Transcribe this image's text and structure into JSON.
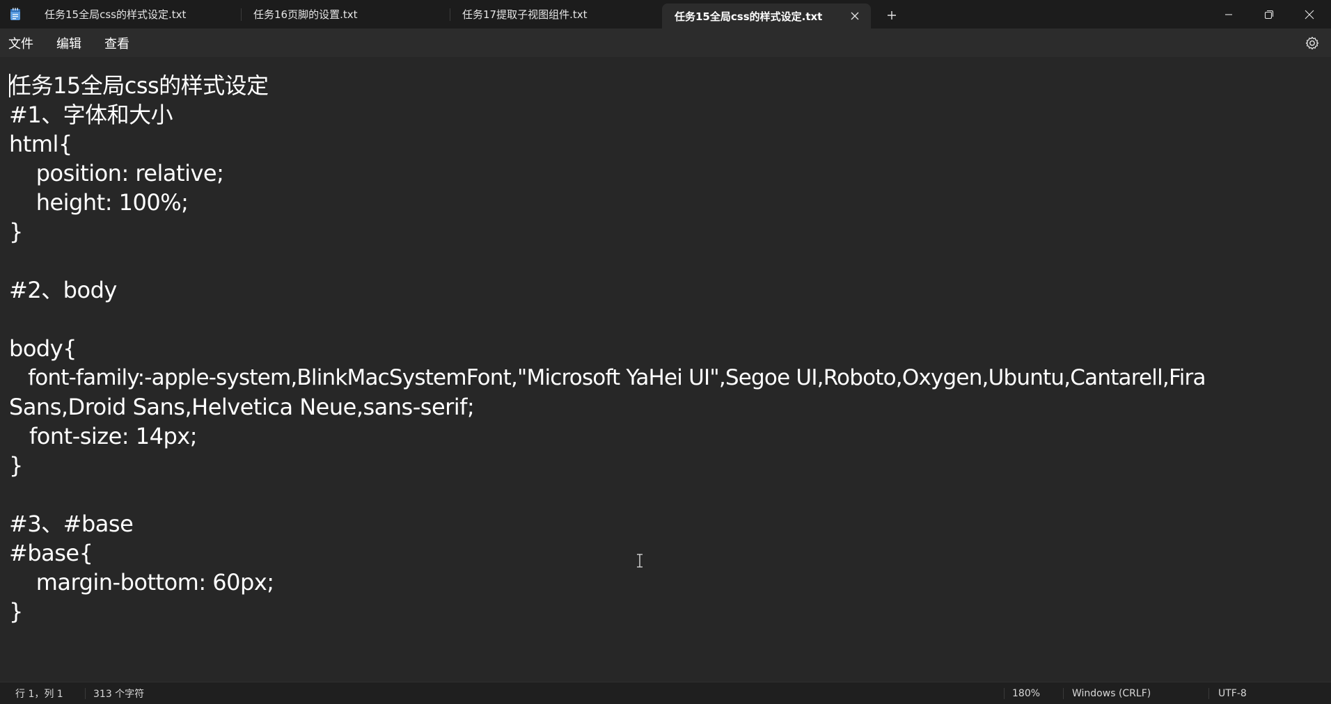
{
  "tabs": [
    {
      "label": "任务15全局css的样式设定.txt",
      "active": false
    },
    {
      "label": "任务16页脚的设置.txt",
      "active": false
    },
    {
      "label": "任务17提取子视图组件.txt",
      "active": false
    },
    {
      "label": "任务15全局css的样式设定.txt",
      "active": true
    }
  ],
  "menu": {
    "file": "文件",
    "edit": "编辑",
    "view": "查看"
  },
  "icons": {
    "app": "notepad-icon",
    "close_tab": "close-icon",
    "new_tab": "plus-icon",
    "minimize": "minimize-icon",
    "restore": "restore-icon",
    "close_window": "close-window-icon",
    "settings": "gear-icon",
    "cursor": "text-cursor-icon"
  },
  "document": {
    "lines": [
      "任务15全局css的样式设定",
      "#1、字体和大小",
      "html{",
      "    position: relative;",
      "    height: 100%;",
      "}",
      "",
      "#2、body",
      "",
      "body{",
      "   font-family:-apple-system,BlinkMacSystemFont,\"Microsoft YaHei UI\",Segoe UI,Roboto,Oxygen,Ubuntu,Cantarell,Fira",
      "Sans,Droid Sans,Helvetica Neue,sans-serif;",
      "   font-size: 14px;",
      "}",
      "",
      "#3、#base",
      "#base{",
      "    margin-bottom: 60px;",
      "}"
    ]
  },
  "status": {
    "position": "行 1，列 1",
    "chars": "313 个字符",
    "zoom": "180%",
    "line_ending": "Windows (CRLF)",
    "encoding": "UTF-8"
  },
  "colors": {
    "titlebar": "#1c1c1c",
    "active_tab": "#2c2c2c",
    "editor_bg": "#272727",
    "text": "#ffffff",
    "app_icon": "#6aa8e8"
  }
}
